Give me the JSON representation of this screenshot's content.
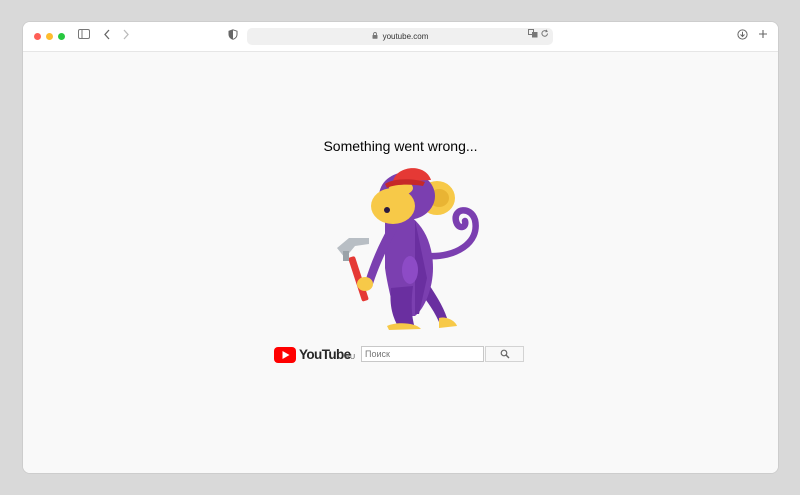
{
  "browser": {
    "url": "youtube.com",
    "icons": [
      "sidebar-icon",
      "back-icon",
      "forward-icon",
      "shield-icon",
      "lock-icon",
      "translate-icon",
      "reload-icon",
      "download-icon",
      "new-tab-icon"
    ]
  },
  "page": {
    "error_title": "Something went wrong...",
    "logo_text": "YouTube",
    "logo_region": "RU",
    "search_placeholder": "Поиск"
  },
  "colors": {
    "youtube_red": "#ff0000",
    "traffic_red": "#ff5f57",
    "traffic_yellow": "#febc2e",
    "traffic_green": "#28c840",
    "monkey_purple": "#7b3fb0",
    "hat_red": "#e53935",
    "face_yellow": "#f7c948"
  }
}
